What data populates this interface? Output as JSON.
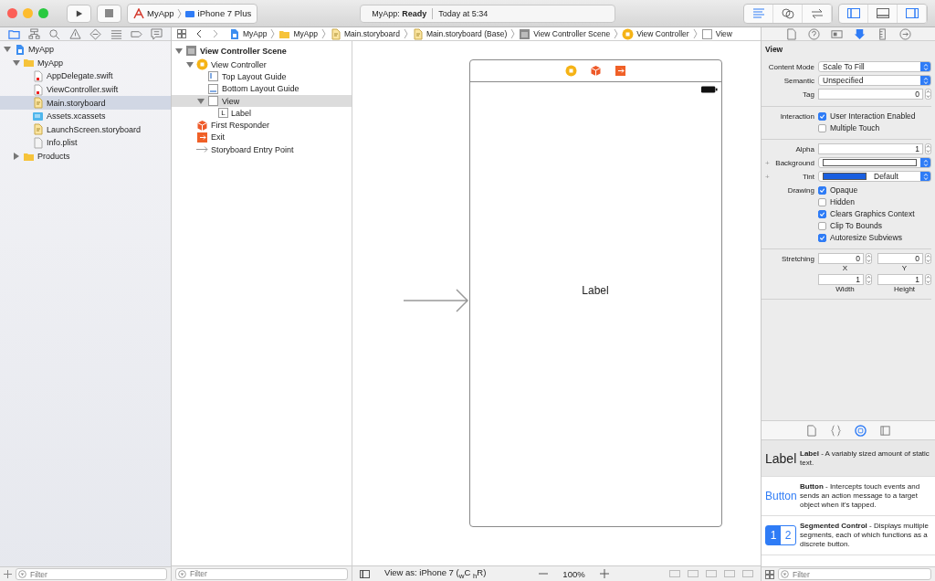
{
  "toolbar": {
    "scheme": "MyApp",
    "device": "iPhone 7 Plus",
    "activity": "MyApp: **Ready**",
    "time": "Today at 5:34",
    "editor_modes": [
      {
        "kind": "standard",
        "selected": true
      },
      {
        "kind": "assistant",
        "selected": false
      },
      {
        "kind": "version",
        "selected": false
      }
    ],
    "panels": [
      {
        "kind": "navigator",
        "on": true
      },
      {
        "kind": "debug",
        "on": false
      },
      {
        "kind": "utilities",
        "on": true
      }
    ]
  },
  "navigator": {
    "tabs": [
      {
        "kind": "folder",
        "selected": true
      },
      {
        "kind": "hierarchy",
        "selected": false
      },
      {
        "kind": "search",
        "selected": false
      },
      {
        "kind": "warning",
        "selected": false
      },
      {
        "kind": "diamond",
        "selected": false
      },
      {
        "kind": "list",
        "selected": false
      },
      {
        "kind": "tag",
        "selected": false
      },
      {
        "kind": "report",
        "selected": false
      }
    ],
    "items": [
      {
        "name": "MyApp",
        "kind": "project",
        "selected": false,
        "expanded": true,
        "children": [
          {
            "name": "MyApp",
            "kind": "folder",
            "selected": false,
            "expanded": true,
            "children": [
              {
                "name": "AppDelegate.swift",
                "kind": "swift",
                "selected": false
              },
              {
                "name": "ViewController.swift",
                "kind": "swift",
                "selected": false
              },
              {
                "name": "Main.storyboard",
                "kind": "storyboard",
                "selected": true
              },
              {
                "name": "Assets.xcassets",
                "kind": "assets",
                "selected": false
              },
              {
                "name": "LaunchScreen.storyboard",
                "kind": "storyboard",
                "selected": false
              },
              {
                "name": "Info.plist",
                "kind": "plist",
                "selected": false
              }
            ]
          },
          {
            "name": "Products",
            "kind": "folder",
            "selected": false,
            "expanded": false
          }
        ]
      }
    ],
    "filter": {
      "placeholder": "Filter"
    }
  },
  "breadcrumb": [
    {
      "text": "MyApp",
      "kind": "project"
    },
    {
      "text": "MyApp",
      "kind": "folder"
    },
    {
      "text": "Main.storyboard",
      "kind": "storyboard"
    },
    {
      "text": "Main.storyboard (Base)",
      "kind": "storyboard"
    },
    {
      "text": "View Controller Scene",
      "kind": "scene"
    },
    {
      "text": "View Controller",
      "kind": "vc"
    },
    {
      "text": "View",
      "kind": "view"
    }
  ],
  "outline": {
    "items": [
      {
        "name": "View Controller Scene",
        "kind": "scene",
        "selected": false,
        "expanded": true,
        "children": [
          {
            "name": "View Controller",
            "kind": "vc",
            "selected": false,
            "expanded": true,
            "children": [
              {
                "name": "Top Layout Guide",
                "kind": "guide-top",
                "selected": false
              },
              {
                "name": "Bottom Layout Guide",
                "kind": "guide-bottom",
                "selected": false
              },
              {
                "name": "View",
                "kind": "view",
                "selected": true,
                "expanded": true,
                "children": [
                  {
                    "name": "Label",
                    "kind": "label",
                    "badge": "L",
                    "selected": false
                  }
                ]
              }
            ]
          },
          {
            "name": "First Responder",
            "kind": "responder",
            "selected": false
          },
          {
            "name": "Exit",
            "kind": "exit",
            "selected": false
          },
          {
            "name": "Storyboard Entry Point",
            "kind": "entry",
            "selected": false
          }
        ]
      }
    ],
    "filter": {
      "placeholder": "Filter"
    }
  },
  "canvas": {
    "label": "Label",
    "view_as": "View as: iPhone 7 ($_{w}$C $_{h}$R)",
    "zoom": "100%"
  },
  "inspector": {
    "tabs": [
      {
        "kind": "file",
        "selected": false
      },
      {
        "kind": "help",
        "selected": false
      },
      {
        "kind": "identity",
        "selected": false
      },
      {
        "kind": "attributes",
        "selected": true
      },
      {
        "kind": "size",
        "selected": false
      },
      {
        "kind": "connections",
        "selected": false
      }
    ],
    "title": "View",
    "sections": [
      {
        "rows": [
          {
            "kind": "popup",
            "label": "Content Mode",
            "value": "Scale To Fill"
          },
          {
            "kind": "popup",
            "label": "Semantic",
            "value": "Unspecified"
          },
          {
            "kind": "stepper",
            "label": "Tag",
            "value": "0"
          }
        ]
      },
      {
        "rows": [
          {
            "kind": "checks",
            "label": "Interaction",
            "items": [
              {
                "text": "User Interaction Enabled",
                "checked": true
              },
              {
                "text": "Multiple Touch",
                "checked": false
              }
            ]
          }
        ]
      },
      {
        "rows": [
          {
            "kind": "stepper",
            "label": "Alpha",
            "value": "1"
          },
          {
            "kind": "color",
            "label": "Background",
            "plus": "+",
            "color": "#ffffff"
          },
          {
            "kind": "color",
            "label": "Tint",
            "plus": "+",
            "color": "#1a5fe0",
            "value": "Default"
          },
          {
            "kind": "checks",
            "label": "Drawing",
            "items": [
              {
                "text": "Opaque",
                "checked": true
              },
              {
                "text": "Hidden",
                "checked": false
              },
              {
                "text": "Clears Graphics Context",
                "checked": true
              },
              {
                "text": "Clip To Bounds",
                "checked": false
              },
              {
                "text": "Autoresize Subviews",
                "checked": true
              }
            ]
          }
        ]
      },
      {
        "rows": [
          {
            "kind": "pair",
            "label": "Stretching",
            "fields": [
              {
                "value": "0",
                "caption": "X"
              },
              {
                "value": "0",
                "caption": "Y"
              }
            ]
          },
          {
            "kind": "pair",
            "fields": [
              {
                "value": "1",
                "caption": "Width"
              },
              {
                "value": "1",
                "caption": "Height"
              }
            ]
          }
        ]
      }
    ]
  },
  "library": {
    "tabs": [
      {
        "kind": "file",
        "selected": false
      },
      {
        "kind": "code",
        "selected": false
      },
      {
        "kind": "object",
        "selected": true
      },
      {
        "kind": "media",
        "selected": false
      }
    ],
    "items": [
      {
        "kind": "label",
        "preview": "Label",
        "text": "**Label** - A variably sized amount of static text.",
        "selected": true
      },
      {
        "kind": "button",
        "preview": "Button",
        "text": "**Button** - Intercepts touch events and sends an action message to a target object when it's tapped.",
        "selected": false
      },
      {
        "kind": "segmented",
        "segments": [
          "1",
          "2"
        ],
        "text": "**Segmented Control** - Displays multiple segments, each of which functions as a discrete button.",
        "selected": false
      }
    ],
    "filter": {
      "placeholder": "Filter"
    }
  }
}
